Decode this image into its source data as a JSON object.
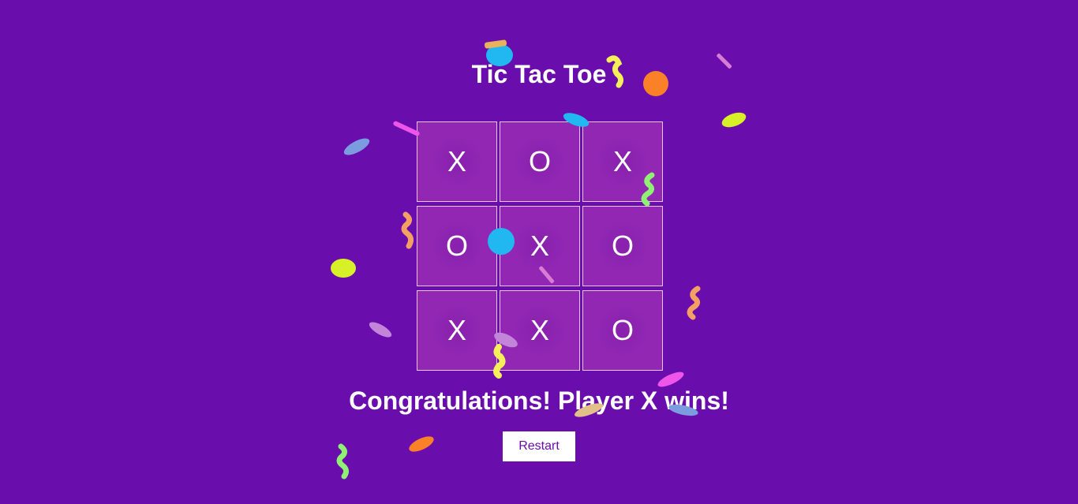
{
  "game": {
    "title": "Tic Tac Toe",
    "board": [
      [
        "X",
        "O",
        "X"
      ],
      [
        "O",
        "X",
        "O"
      ],
      [
        "X",
        "X",
        "O"
      ]
    ],
    "status_message": "Congratulations! Player X wins!",
    "restart_label": "Restart"
  },
  "colors": {
    "background": "#6a0dad",
    "cell": "#9127b3",
    "text": "#ffffff",
    "button_text": "#6a0dad"
  }
}
